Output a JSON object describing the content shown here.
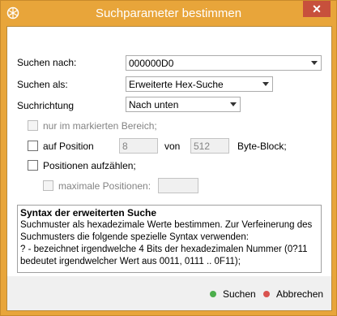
{
  "window": {
    "title": "Suchparameter bestimmen"
  },
  "colors": {
    "titlebar": "#e8a53a",
    "close": "#c7503c",
    "ok_dot": "#4cae4c",
    "cancel_dot": "#d9534f"
  },
  "form": {
    "search_for_label": "Suchen nach:",
    "search_for_value": "000000D0",
    "search_as_label": "Suchen als:",
    "search_as_value": "Erweiterte Hex-Suche",
    "direction_label": "Suchrichtung",
    "direction_value": "Nach unten",
    "only_selection_label": "nur im markierten Bereich;",
    "at_position_label": "auf Position",
    "position_value": "8",
    "of_label": "von",
    "block_value": "512",
    "block_label": "Byte-Block;",
    "list_positions_label": "Positionen aufzählen;",
    "max_positions_label": "maximale Positionen:",
    "max_positions_value": ""
  },
  "help": {
    "title": "Syntax der erweiterten Suche",
    "lines": [
      "Suchmuster als hexadezimale Werte bestimmen. Zur Verfeinerung des",
      "Suchmusters die folgende spezielle Syntax verwenden:",
      " ? - bezeichnet irgendwelche 4 Bits der hexadezimalen Nummer (0?11",
      "bedeutet irgendwelcher Wert aus 0011, 0111 .. 0F11);"
    ]
  },
  "buttons": {
    "ok": "Suchen",
    "cancel": "Abbrechen"
  }
}
